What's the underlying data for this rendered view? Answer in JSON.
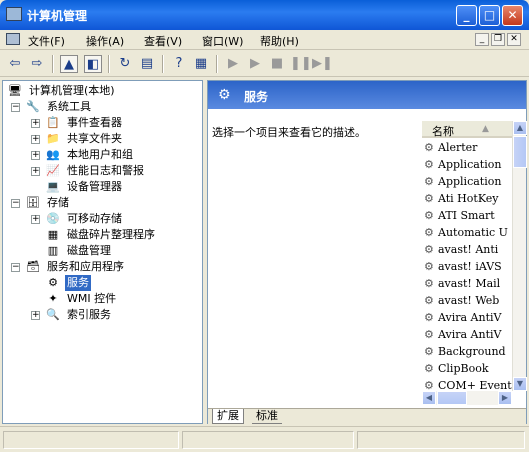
{
  "window": {
    "title": "计算机管理",
    "minimize": "_",
    "maximize": "□",
    "close": "✕"
  },
  "menu": {
    "items": [
      "文件(F)",
      "操作(A)",
      "查看(V)",
      "窗口(W)",
      "帮助(H)"
    ]
  },
  "tree": {
    "root": "计算机管理(本地)",
    "nodes": [
      {
        "label": "系统工具",
        "icon": "tools-icon"
      },
      {
        "label": "事件查看器",
        "icon": "event-viewer-icon"
      },
      {
        "label": "共享文件夹",
        "icon": "shared-folder-icon"
      },
      {
        "label": "本地用户和组",
        "icon": "users-icon"
      },
      {
        "label": "性能日志和警报",
        "icon": "performance-icon"
      },
      {
        "label": "设备管理器",
        "icon": "device-manager-icon"
      },
      {
        "label": "存储",
        "icon": "storage-icon"
      },
      {
        "label": "可移动存储",
        "icon": "removable-storage-icon"
      },
      {
        "label": "磁盘碎片整理程序",
        "icon": "defrag-icon"
      },
      {
        "label": "磁盘管理",
        "icon": "disk-management-icon"
      },
      {
        "label": "服务和应用程序",
        "icon": "services-apps-icon"
      },
      {
        "label": "服务",
        "icon": "services-icon"
      },
      {
        "label": "WMI 控件",
        "icon": "wmi-icon"
      },
      {
        "label": "索引服务",
        "icon": "index-service-icon"
      }
    ]
  },
  "panel": {
    "title": "服务",
    "description": "选择一个项目来查看它的描述。",
    "column_header": "名称",
    "services": [
      "Alerter",
      "Application",
      "Application",
      "Ati HotKey",
      "ATI Smart",
      "Automatic U",
      "avast! Anti",
      "avast! iAVS",
      "avast! Mail",
      "avast! Web",
      "Avira AntiV",
      "Avira AntiV",
      "Background",
      "ClipBook",
      "COM+ Event"
    ]
  },
  "tabs": [
    "扩展",
    "标准"
  ]
}
